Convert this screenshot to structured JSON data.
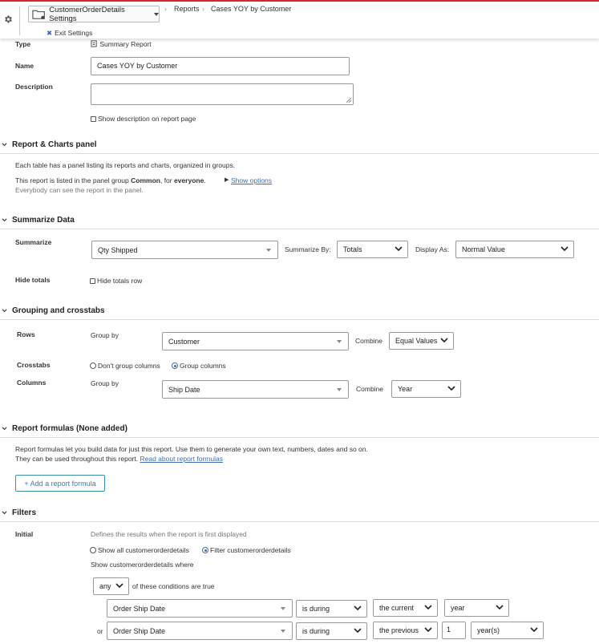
{
  "header": {
    "table_settings_label": "CustomerOrderDetails Settings",
    "breadcrumb": [
      "Reports",
      "Cases YOY by Customer"
    ],
    "exit_label": "Exit Settings"
  },
  "fields": {
    "type_label": "Type",
    "type_value": "Summary Report",
    "name_label": "Name",
    "name_value": "Cases YOY by Customer",
    "description_label": "Description",
    "description_value": "",
    "show_description_label": "Show description on report page"
  },
  "report_charts": {
    "title": "Report & Charts panel",
    "line1": "Each table has a panel listing its reports and charts, organized in groups.",
    "line2_prefix": "This report is listed in the panel group",
    "group_name": "Common",
    "line2_mid": ", for",
    "audience": "everyone",
    "line2_end": ".",
    "show_options": "Show options",
    "line3": "Everybody can see the report in the panel."
  },
  "summarize": {
    "title": "Summarize Data",
    "label": "Summarize",
    "field_value": "Qty Shipped",
    "by_label": "Summarize By:",
    "by_value": "Totals",
    "display_label": "Display As:",
    "display_value": "Normal Value",
    "hide_totals_label": "Hide totals",
    "hide_totals_row": "Hide totals row"
  },
  "grouping": {
    "title": "Grouping and crosstabs",
    "rows_label": "Rows",
    "group_by": "Group by",
    "rows_field": "Customer",
    "combine_label": "Combine",
    "rows_combine": "Equal Values",
    "crosstabs_label": "Crosstabs",
    "dont_group": "Don't group columns",
    "group_columns": "Group columns",
    "columns_label": "Columns",
    "columns_field": "Ship Date",
    "columns_combine": "Year"
  },
  "formulas": {
    "title": "Report formulas (None added)",
    "line1": "Report formulas let you build data for just this report. Use them to generate your own text, numbers, dates and so on.",
    "line2": "They can be used throughout this report.",
    "read_more": "Read about report formulas",
    "add_button": "+ Add a report formula"
  },
  "filters": {
    "title": "Filters",
    "initial_label": "Initial",
    "initial_desc": "Defines the results when the report is first displayed",
    "show_all": "Show all customerorderdetails",
    "filter_opt": "Filter customerorderdetails",
    "show_where": "Show customerorderdetails where",
    "any_value": "any",
    "conditions_text": "of these conditions are true",
    "or_label": "or",
    "cond1": {
      "field": "Order Ship Date",
      "op": "is during",
      "period": "the current",
      "unit": "year"
    },
    "cond2": {
      "field": "Order Ship Date",
      "op": "is during",
      "period": "the previous",
      "count": "1",
      "unit": "year(s)"
    }
  },
  "colors": {
    "accent": "#3a6fb0",
    "topbar_border": "#d9262b"
  }
}
